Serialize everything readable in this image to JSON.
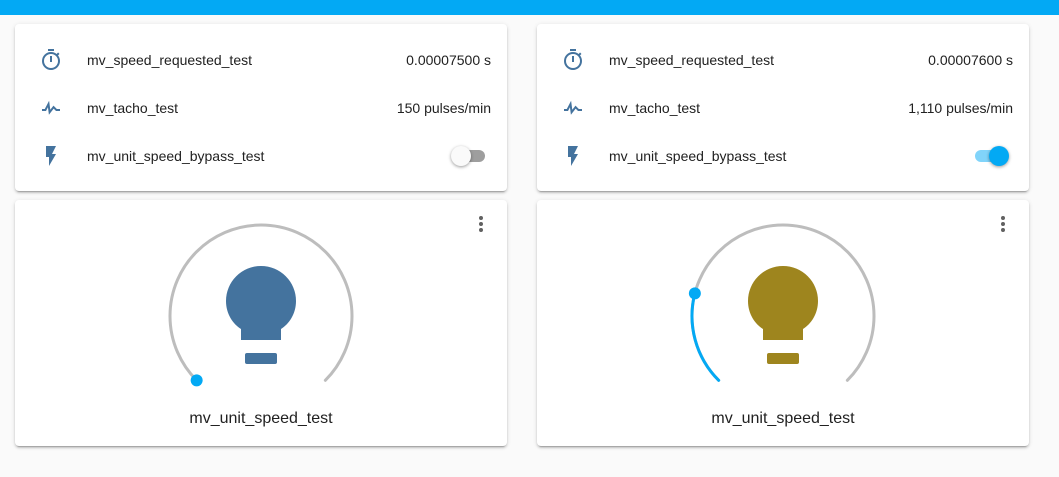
{
  "colors": {
    "accent": "#03a9f4",
    "icon": "#44739e",
    "bulb_off": "#44739e",
    "bulb_on": "#9e851e",
    "arc_track": "#bdbdbd"
  },
  "cards": [
    {
      "rows": [
        {
          "icon": "timer-icon",
          "name": "mv_speed_requested_test",
          "state": "0.00007500 s"
        },
        {
          "icon": "pulse-icon",
          "name": "mv_tacho_test",
          "state": "150 pulses/min"
        },
        {
          "icon": "flash-icon",
          "name": "mv_unit_speed_bypass_test",
          "toggle": "off"
        }
      ],
      "light": {
        "name": "mv_unit_speed_test",
        "brightness_fraction": 0.0,
        "state": "off"
      }
    },
    {
      "rows": [
        {
          "icon": "timer-icon",
          "name": "mv_speed_requested_test",
          "state": "0.00007600 s"
        },
        {
          "icon": "pulse-icon",
          "name": "mv_tacho_test",
          "state": "1,110 pulses/min"
        },
        {
          "icon": "flash-icon",
          "name": "mv_unit_speed_bypass_test",
          "toggle": "on"
        }
      ],
      "light": {
        "name": "mv_unit_speed_test",
        "brightness_fraction": 0.22,
        "state": "on"
      }
    }
  ]
}
